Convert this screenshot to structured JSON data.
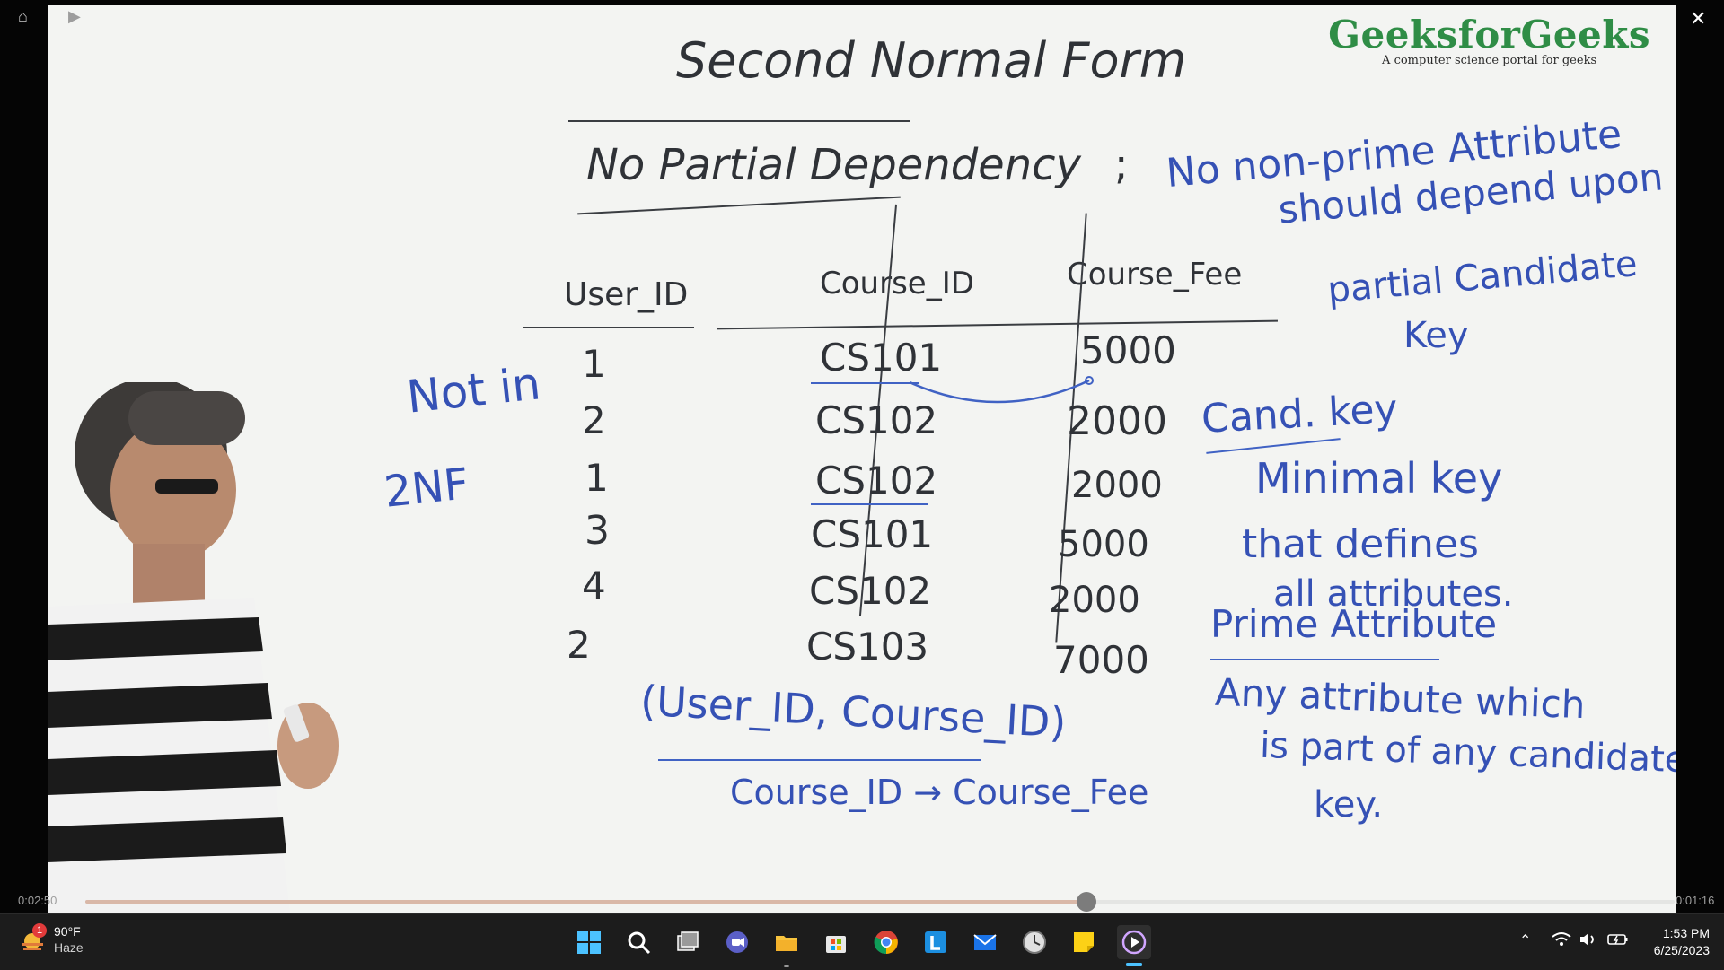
{
  "player": {
    "elapsed": "0:02:50",
    "duration": "0:01:16",
    "progress": 0.63
  },
  "brand": {
    "name": "GeeksforGeeks",
    "tagline": "A computer science portal for geeks",
    "color": "#2f8d46"
  },
  "board": {
    "title": "Second Normal Form",
    "subtitle": "No Partial Dependency",
    "rule_line1": "No non-prime Attribute",
    "rule_line2": "should depend upon",
    "rule_line3": "partial Candidate",
    "rule_line4": "Key",
    "table": {
      "headers": [
        "User_ID",
        "Course_ID",
        "Course_Fee"
      ],
      "rows": [
        [
          "1",
          "CS101",
          "5000"
        ],
        [
          "2",
          "CS102",
          "2000"
        ],
        [
          "1",
          "CS102",
          "2000"
        ],
        [
          "3",
          "CS101",
          "5000"
        ],
        [
          "4",
          "CS102",
          "2000"
        ],
        [
          "2",
          "CS103",
          "7000"
        ]
      ]
    },
    "not_in_line1": "Not in",
    "not_in_line2": "2NF",
    "composite_key": "(User_ID, Course_ID)",
    "dependency": "Course_ID → Course_Fee",
    "cand_key_label": "Cand. key",
    "cand_key_def1": "Minimal key",
    "cand_key_def2": "that defines",
    "cand_key_def3": "all attributes.",
    "prime_label": "Prime Attribute",
    "prime_def1": "Any attribute which",
    "prime_def2": "is part of any candidate",
    "prime_def3": "key."
  },
  "taskbar": {
    "weather_temp": "90°F",
    "weather_cond": "Haze",
    "weather_badge": "1",
    "time": "1:53 PM",
    "date": "6/25/2023",
    "apps": [
      "start-icon",
      "search-icon",
      "task-view-icon",
      "teams-icon",
      "file-explorer-icon",
      "store-icon",
      "chrome-icon",
      "l-app-icon",
      "mail-icon",
      "clock-app-icon",
      "sticky-notes-icon",
      "media-player-icon"
    ]
  }
}
